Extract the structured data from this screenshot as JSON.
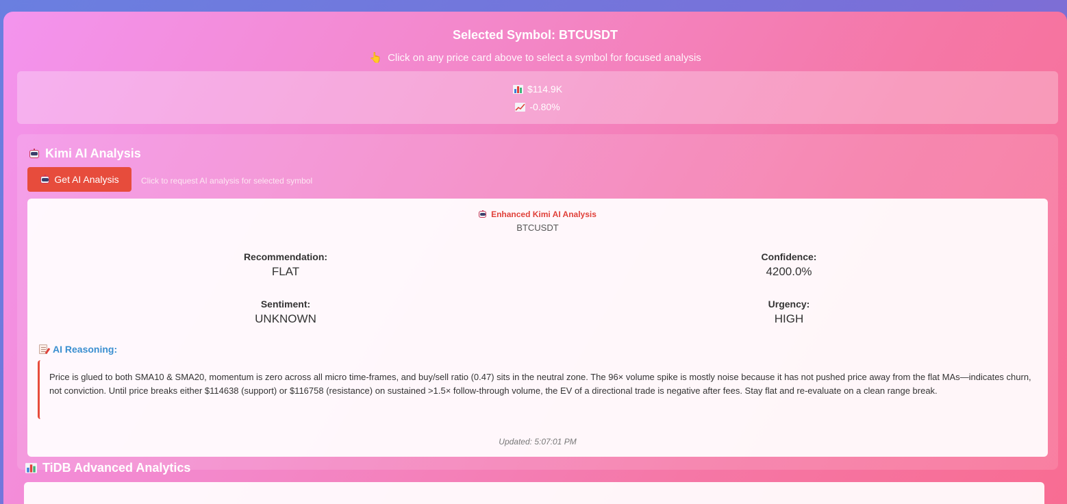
{
  "selected": {
    "title": "Selected Symbol: BTCUSDT",
    "hint_icon": "pointing-hand-icon",
    "hint_glyph": "👆",
    "hint": "Click on any price card above to select a symbol for focused analysis"
  },
  "price": {
    "price_icon": "bar-chart-icon",
    "value": "$114.9K",
    "change_icon": "trend-chart-icon",
    "change": "-0.80%"
  },
  "ai": {
    "section_title": "Kimi AI Analysis",
    "section_icon": "robot-icon",
    "button_label": "Get AI Analysis",
    "button_hint": "Click to request AI analysis for selected symbol",
    "button_color": "#e74c3c",
    "card": {
      "header": "Enhanced Kimi AI Analysis",
      "symbol": "BTCUSDT",
      "recommendation_label": "Recommendation:",
      "recommendation": "FLAT",
      "confidence_label": "Confidence:",
      "confidence": "4200.0%",
      "sentiment_label": "Sentiment:",
      "sentiment": "UNKNOWN",
      "urgency_label": "Urgency:",
      "urgency": "HIGH",
      "reasoning_title": "AI Reasoning:",
      "reasoning_icon": "memo-icon",
      "reasoning": "Price is glued to both SMA10 & SMA20, momentum is zero across all micro time-frames, and buy/sell ratio (0.47) sits in the neutral zone. The 96× volume spike is mostly noise because it has not pushed price away from the flat MAs—indicates churn, not conviction. Until price breaks either $114638 (support) or $116758 (resistance) on sustained >1.5× follow-through volume, the EV of a directional trade is negative after fees. Stay flat and re-evaluate on a clean range break.",
      "updated": "Updated: 5:07:01 PM"
    }
  },
  "tidb": {
    "section_title": "TiDB Advanced Analytics",
    "section_icon": "bar-chart-icon"
  }
}
